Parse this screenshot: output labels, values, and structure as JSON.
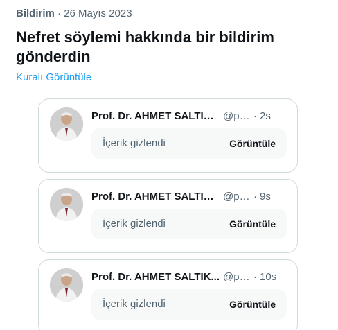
{
  "notification": {
    "kind": "Bildirim",
    "separator": " · ",
    "date": "26 Mayıs 2023",
    "title": "Nefret söylemi hakkında bir bildirim gönderdin",
    "rule_link": "Kuralı Görüntüle"
  },
  "posts": [
    {
      "name": "Prof. Dr. AHMET SALTIK ...",
      "handle": "@pr...",
      "separator": "·",
      "time": "2s",
      "hidden_text": "İçerik gizlendi",
      "view_label": "Görüntüle"
    },
    {
      "name": "Prof. Dr. AHMET SALTIK ...",
      "handle": "@pr...",
      "separator": "·",
      "time": "9s",
      "hidden_text": "İçerik gizlendi",
      "view_label": "Görüntüle"
    },
    {
      "name": "Prof. Dr. AHMET SALTIK...",
      "handle": "@pr...",
      "separator": "·",
      "time": "10s",
      "hidden_text": "İçerik gizlendi",
      "view_label": "Görüntüle"
    }
  ],
  "colors": {
    "link": "#1d9bf0",
    "secondary_text": "#536471",
    "primary_text": "#0f1419",
    "card_border": "#cfd9de",
    "hidden_box_bg": "#f7f9f9"
  }
}
